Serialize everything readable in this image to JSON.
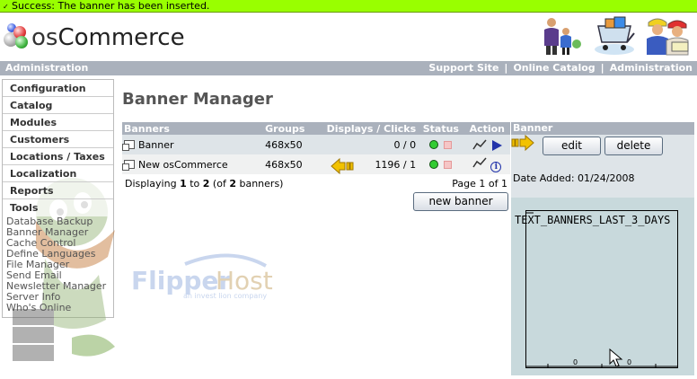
{
  "success": {
    "message": "Success: The banner has been inserted."
  },
  "logo": {
    "os": "os",
    "commerce": "Commerce"
  },
  "nav": {
    "left": "Administration",
    "links": [
      "Support Site",
      "Online Catalog",
      "Administration"
    ],
    "separator": "|"
  },
  "sidebar": {
    "headings": [
      "Configuration",
      "Catalog",
      "Modules",
      "Customers",
      "Locations / Taxes",
      "Localization",
      "Reports",
      "Tools"
    ],
    "tools": [
      "Database Backup",
      "Banner Manager",
      "Cache Control",
      "Define Languages",
      "File Manager",
      "Send Email",
      "Newsletter Manager",
      "Server Info",
      "Who's Online"
    ]
  },
  "watermark": {
    "flipper": "Flipper",
    "host": "Host",
    "tagline": "an invest lion company"
  },
  "page": {
    "title": "Banner Manager"
  },
  "table": {
    "headers": {
      "banners": "Banners",
      "groups": "Groups",
      "displays": "Displays / Clicks",
      "status": "Status",
      "action": "Action"
    },
    "rows": [
      {
        "name": "Banner",
        "group": "468x50",
        "displays": "0 / 0"
      },
      {
        "name": "New osCommerce",
        "group": "468x50",
        "displays": "1196 / 1"
      }
    ],
    "paging": {
      "prefix": "Displaying",
      "from": "1",
      "to_word": "to",
      "to": "2",
      "of_open": "(of",
      "total": "2",
      "suffix": "banners)",
      "page": "Page 1 of 1"
    },
    "new_button": "new banner"
  },
  "panel": {
    "header": "Banner",
    "edit": "edit",
    "delete": "delete",
    "date_added": "Date Added: 01/24/2008",
    "graph_title": "TEXT_BANNERS_LAST_3_DAYS",
    "graph_ticks": [
      "0",
      "0"
    ]
  },
  "colors": {
    "success_bg": "#99ff00",
    "header_bar": "#aab1bc",
    "row_selected": "#dee4e8",
    "graph_bg": "#c8d9dc"
  }
}
